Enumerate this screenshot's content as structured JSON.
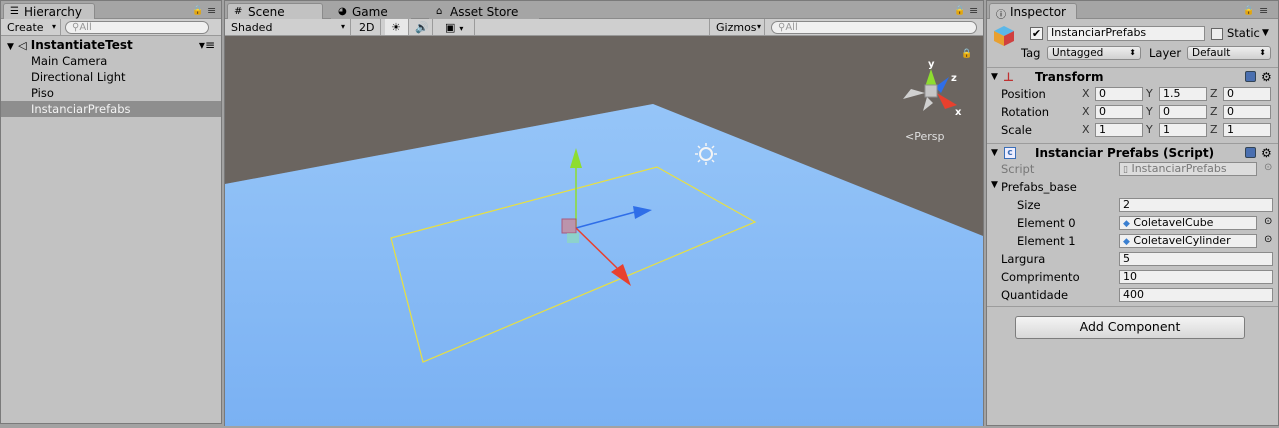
{
  "hierarchy": {
    "tab_label": "Hierarchy",
    "create_label": "Create",
    "search_placeholder": "All",
    "scene_name": "InstantiateTest",
    "items": [
      "Main Camera",
      "Directional Light",
      "Piso",
      "InstanciarPrefabs"
    ],
    "selected_index": 3
  },
  "scene": {
    "tabs": [
      "Scene",
      "Game",
      "Asset Store"
    ],
    "active_tab": "Scene",
    "shading_mode": "Shaded",
    "mode_2d": "2D",
    "gizmos_label": "Gizmos",
    "search_placeholder": "All",
    "projection_label": "Persp",
    "gizmo_axes": [
      "y",
      "z",
      "x"
    ],
    "colors": {
      "ground": "#83b8f4",
      "sky": "#6b6560",
      "x_axis": "#e8402e",
      "y_axis": "#8edd30",
      "z_axis": "#2f6ee8",
      "bounds": "#e8e040"
    }
  },
  "inspector": {
    "tab_label": "Inspector",
    "object_name": "InstanciarPrefabs",
    "active": true,
    "static_label": "Static",
    "static_checked": false,
    "tag_label": "Tag",
    "tag_value": "Untagged",
    "layer_label": "Layer",
    "layer_value": "Default",
    "transform": {
      "title": "Transform",
      "rows": [
        {
          "label": "Position",
          "x": "0",
          "y": "1.5",
          "z": "0"
        },
        {
          "label": "Rotation",
          "x": "0",
          "y": "0",
          "z": "0"
        },
        {
          "label": "Scale",
          "x": "1",
          "y": "1",
          "z": "1"
        }
      ],
      "axis_labels": [
        "X",
        "Y",
        "Z"
      ]
    },
    "script_component": {
      "title": "Instanciar Prefabs (Script)",
      "script_label": "Script",
      "script_value": "InstanciarPrefabs",
      "array_label": "Prefabs_base",
      "size_label": "Size",
      "size_value": "2",
      "elements": [
        {
          "label": "Element 0",
          "value": "ColetavelCube"
        },
        {
          "label": "Element 1",
          "value": "ColetavelCylinder"
        }
      ],
      "fields": [
        {
          "label": "Largura",
          "value": "5"
        },
        {
          "label": "Comprimento",
          "value": "10"
        },
        {
          "label": "Quantidade",
          "value": "400"
        }
      ]
    },
    "add_component_label": "Add Component"
  }
}
